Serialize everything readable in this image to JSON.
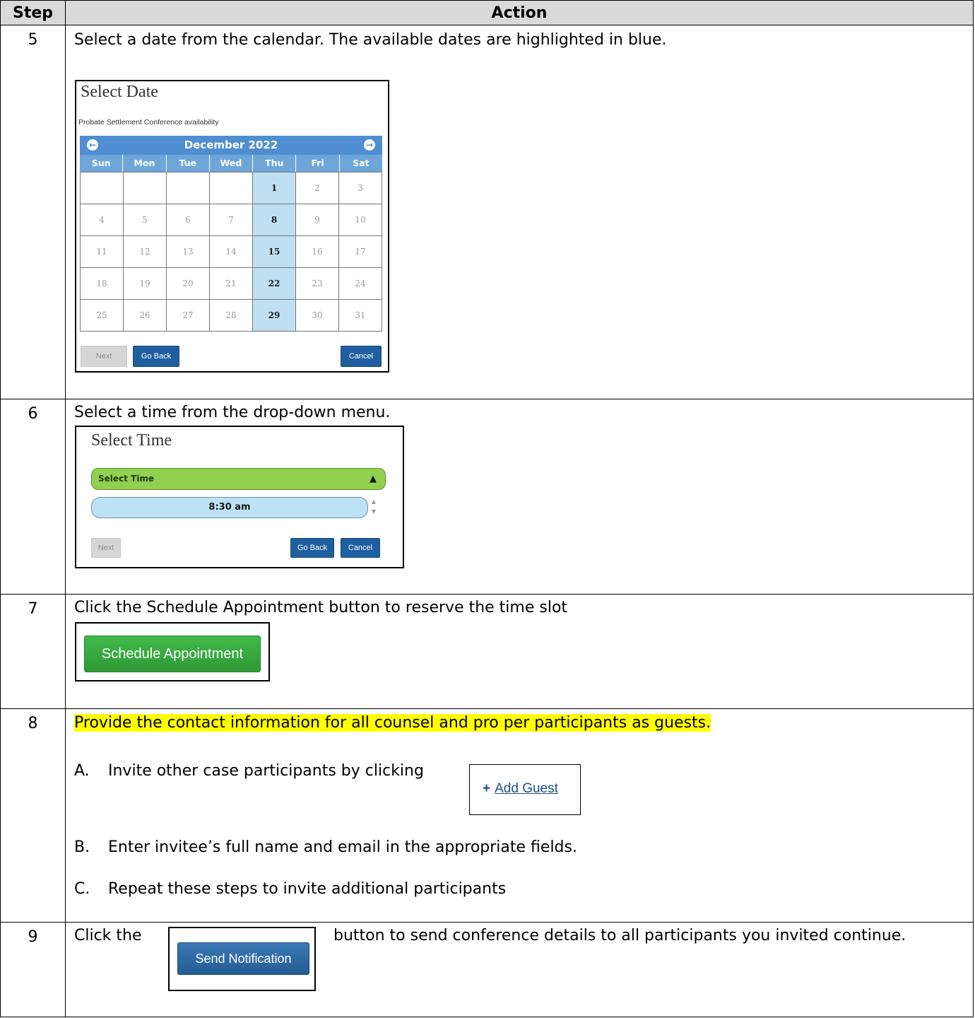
{
  "table": {
    "col_step": "Step",
    "col_action": "Action"
  },
  "step5": {
    "num": "5",
    "text": "Select a date from the calendar. The available dates are highlighted in blue.",
    "widget": {
      "title": "Select Date",
      "subtitle": "Probate Settlement Conference availability",
      "month": "December 2022",
      "prev_icon": "arrow-left-circle-icon",
      "next_icon": "arrow-right-circle-icon",
      "weekdays": [
        "Sun",
        "Mon",
        "Tue",
        "Wed",
        "Thu",
        "Fri",
        "Sat"
      ],
      "weeks": [
        [
          "",
          "",
          "",
          "",
          "1",
          "2",
          "3"
        ],
        [
          "4",
          "5",
          "6",
          "7",
          "8",
          "9",
          "10"
        ],
        [
          "11",
          "12",
          "13",
          "14",
          "15",
          "16",
          "17"
        ],
        [
          "18",
          "19",
          "20",
          "21",
          "22",
          "23",
          "24"
        ],
        [
          "25",
          "26",
          "27",
          "28",
          "29",
          "30",
          "31"
        ]
      ],
      "available": [
        "1",
        "8",
        "15",
        "22",
        "29"
      ],
      "next_label": "Next",
      "back_label": "Go Back",
      "cancel_label": "Cancel"
    }
  },
  "step6": {
    "num": "6",
    "text": "Select a time from the drop-down menu.",
    "widget": {
      "title": "Select Time",
      "dropdown_label": "Select Time",
      "option": "8:30 am",
      "next_label": "Next",
      "back_label": "Go Back",
      "cancel_label": "Cancel"
    }
  },
  "step7": {
    "num": "7",
    "text": "Click the Schedule Appointment button to reserve the time slot",
    "button": "Schedule Appointment"
  },
  "step8": {
    "num": "8",
    "text": "Provide the contact information for all counsel and pro per participants as guests.",
    "a_marker": "A.",
    "a_text": "Invite other case participants by clicking",
    "add_guest": "Add Guest",
    "b_marker": "B.",
    "b_text": "Enter invitee’s full name and email in the appropriate fields.",
    "c_marker": "C.",
    "c_text": "Repeat these steps to invite additional participants"
  },
  "step9": {
    "num": "9",
    "text_before": "Click the",
    "button": "Send Notification",
    "text_after": "button to send conference details to all participants you invited continue."
  },
  "colors": {
    "calendar_header": "#4f8ed0",
    "available_day": "#bfe0f2",
    "highlight": "#ffff00",
    "green_button": "#3aa842",
    "blue_button": "#1f5f9f"
  }
}
